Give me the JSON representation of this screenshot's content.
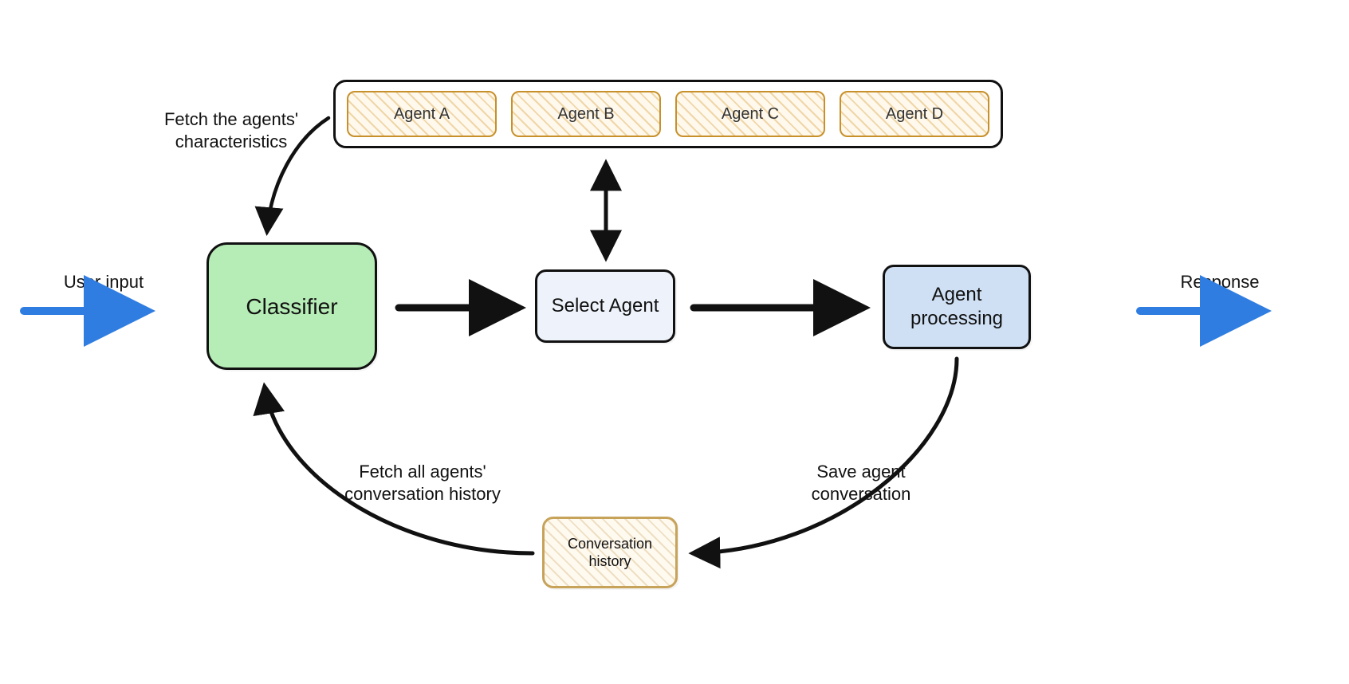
{
  "inputs": {
    "user_input_label": "User input",
    "response_label": "Response"
  },
  "nodes": {
    "classifier": "Classifier",
    "select_agent": "Select Agent",
    "agent_processing": "Agent\nprocessing",
    "conversation_history": "Conversation\nhistory"
  },
  "agents": {
    "items": [
      "Agent A",
      "Agent B",
      "Agent C",
      "Agent D"
    ]
  },
  "annotations": {
    "fetch_characteristics": "Fetch the agents'\ncharacteristics",
    "fetch_history": "Fetch all agents'\nconversation history",
    "save_conversation": "Save agent\nconversation"
  },
  "colors": {
    "arrow_blue": "#2f7de1",
    "arrow_black": "#111111",
    "agent_border": "#c8902a",
    "classifier_fill": "#b6ecb6",
    "select_fill": "#eef3fb",
    "processing_fill": "#cfe0f4"
  }
}
